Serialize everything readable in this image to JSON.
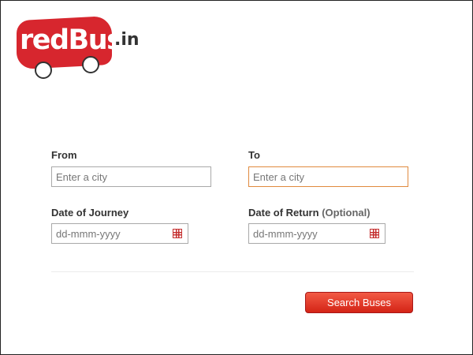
{
  "logo": {
    "brand": "redBus",
    "tld": ".in"
  },
  "form": {
    "from": {
      "label": "From",
      "placeholder": "Enter a city"
    },
    "to": {
      "label": "To",
      "placeholder": "Enter a city"
    },
    "journey": {
      "label": "Date of Journey",
      "placeholder": "dd-mmm-yyyy"
    },
    "return": {
      "label": "Date of Return",
      "optional": "(Optional)",
      "placeholder": "dd-mmm-yyyy"
    },
    "search_label": "Search Buses"
  },
  "colors": {
    "brand_red": "#d7262e",
    "focus_border": "#e08a3e",
    "button_gradient_top": "#f25a45",
    "button_gradient_bottom": "#d42416"
  },
  "icons": {
    "calendar": "calendar-icon"
  }
}
